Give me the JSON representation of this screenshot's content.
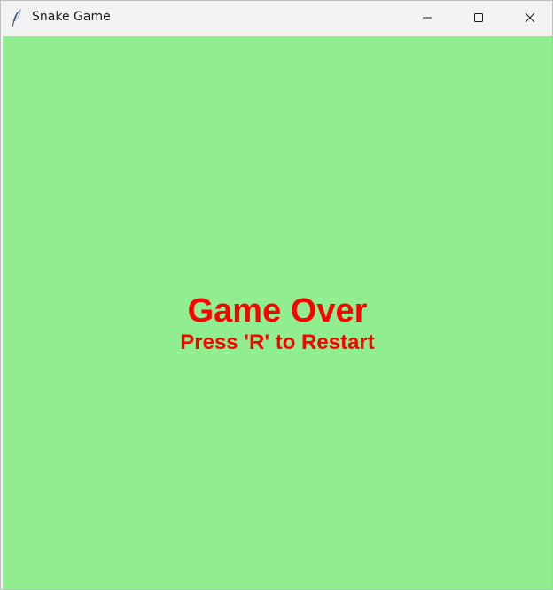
{
  "window": {
    "title": "Snake Game",
    "icon": "feather-icon",
    "controls": {
      "minimize_icon": "minimize-icon",
      "maximize_icon": "maximize-icon",
      "close_icon": "close-icon"
    }
  },
  "game": {
    "background_color": "#90ee90",
    "text_color": "#ff0000",
    "status": "Game Over",
    "prompt": "Press 'R' to Restart"
  }
}
